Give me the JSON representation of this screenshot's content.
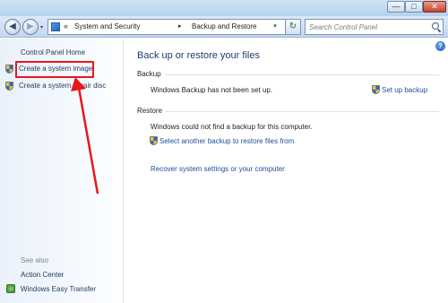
{
  "window": {
    "minimize_glyph": "—",
    "maximize_glyph": "□",
    "close_glyph": "✕"
  },
  "navigation": {
    "back_glyph": "◀",
    "forward_glyph": "▶",
    "history_glyph": "▾",
    "address_overflow": "«",
    "breadcrumbs": [
      "System and Security",
      "Backup and Restore"
    ],
    "separator": "▸",
    "refresh_glyph": "↻",
    "search_placeholder": "Search Control Panel"
  },
  "sidebar": {
    "home": "Control Panel Home",
    "links": [
      {
        "label": "Create a system image",
        "icon": "uac-shield-icon"
      },
      {
        "label": "Create a system repair disc",
        "icon": "uac-shield-icon"
      }
    ],
    "see_also_heading": "See also",
    "see_also": [
      {
        "label": "Action Center",
        "icon": ""
      },
      {
        "label": "Windows Easy Transfer",
        "icon": "easy-transfer-icon"
      }
    ]
  },
  "main": {
    "help_glyph": "?",
    "title": "Back up or restore your files",
    "backup": {
      "heading": "Backup",
      "status": "Windows Backup has not been set up.",
      "action": "Set up backup"
    },
    "restore": {
      "heading": "Restore",
      "status": "Windows could not find a backup for this computer.",
      "action": "Select another backup to restore files from",
      "recover": "Recover system settings or your computer"
    }
  },
  "annotation": {
    "color": "#e8181a"
  }
}
